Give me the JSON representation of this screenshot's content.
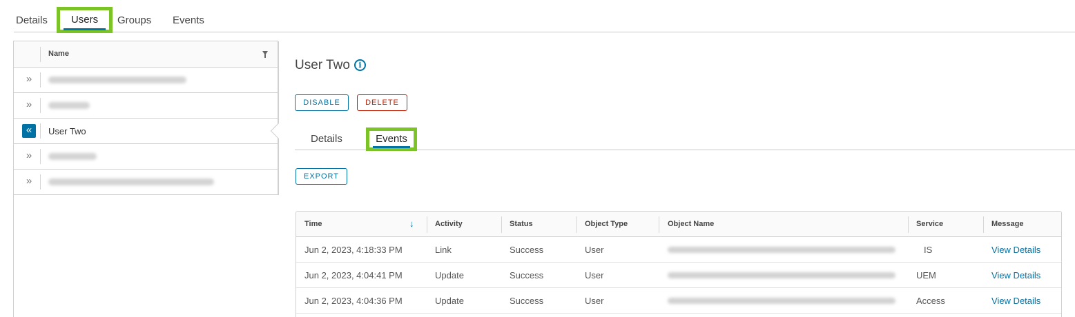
{
  "top_tabs": [
    {
      "label": "Details"
    },
    {
      "label": "Users"
    },
    {
      "label": "Groups"
    },
    {
      "label": "Events"
    }
  ],
  "user_list": {
    "header_name": "Name",
    "rows": [
      {
        "name": "",
        "blurred": true
      },
      {
        "name": "",
        "blurred": true
      },
      {
        "name": "User Two",
        "blurred": false,
        "selected": true
      },
      {
        "name": "",
        "blurred": true
      },
      {
        "name": "",
        "blurred": true
      }
    ]
  },
  "detail": {
    "title": "User Two",
    "info_icon": "info-icon",
    "disable_label": "DISABLE",
    "delete_label": "DELETE",
    "tabs": [
      {
        "label": "Details"
      },
      {
        "label": "Events"
      }
    ],
    "export_label": "EXPORT"
  },
  "events_table": {
    "columns": [
      "Time",
      "Activity",
      "Status",
      "Object Type",
      "Object Name",
      "Service",
      "Message"
    ],
    "sort_column": "Time",
    "sort_direction": "descending",
    "rows": [
      {
        "time": "Jun 2, 2023, 4:18:33 PM",
        "activity": "Link",
        "status": "Success",
        "object_type": "User",
        "object_name": "",
        "service": "IS",
        "message": "View Details"
      },
      {
        "time": "Jun 2, 2023, 4:04:41 PM",
        "activity": "Update",
        "status": "Success",
        "object_type": "User",
        "object_name": "",
        "service": "UEM",
        "message": "View Details"
      },
      {
        "time": "Jun 2, 2023, 4:04:36 PM",
        "activity": "Update",
        "status": "Success",
        "object_type": "User",
        "object_name": "",
        "service": "Access",
        "message": "View Details"
      }
    ]
  },
  "colors": {
    "accent": "#0072a3",
    "danger": "#c21d00",
    "highlight": "#7cc327"
  }
}
